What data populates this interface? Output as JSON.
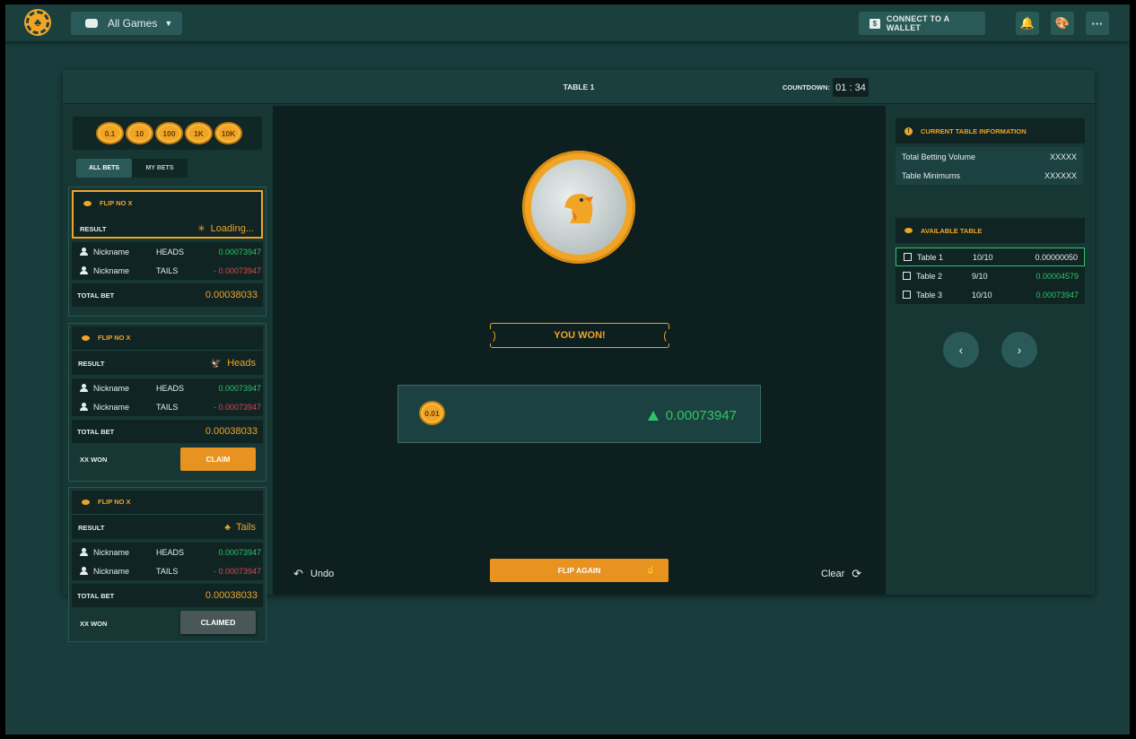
{
  "header": {
    "games_label": "All Games",
    "wallet_label": "CONNECT TO A WALLET"
  },
  "table": {
    "title": "TABLE 1",
    "countdown_label": "COUNTDOWN:",
    "countdown_value": "01 : 34"
  },
  "chips": [
    "0.1",
    "10",
    "100",
    "1K",
    "10K"
  ],
  "bet_tabs": [
    "ALL BETS",
    "MY BETS"
  ],
  "cards": [
    {
      "flip_label": "FLIP NO X",
      "result_label": "RESULT",
      "result_value": "Loading...",
      "bets": [
        {
          "nick": "Nickname",
          "side": "HEADS",
          "amount": "0.00073947"
        },
        {
          "nick": "Nickname",
          "side": "TAILS",
          "amount": "- 0.00073947"
        }
      ],
      "total_label": "TOTAL BET",
      "total_value": "0.00038033"
    },
    {
      "flip_label": "FLIP NO X",
      "result_label": "RESULT",
      "result_value": "Heads",
      "bets": [
        {
          "nick": "Nickname",
          "side": "HEADS",
          "amount": "0.00073947"
        },
        {
          "nick": "Nickname",
          "side": "TAILS",
          "amount": "- 0.00073947"
        }
      ],
      "total_label": "TOTAL BET",
      "total_value": "0.00038033",
      "won_label": "XX WON",
      "action_label": "CLAIM"
    },
    {
      "flip_label": "FLIP NO X",
      "result_label": "RESULT",
      "result_value": "Tails",
      "bets": [
        {
          "nick": "Nickname",
          "side": "HEADS",
          "amount": "0.00073947"
        },
        {
          "nick": "Nickname",
          "side": "TAILS",
          "amount": "- 0.00073947"
        }
      ],
      "total_label": "TOTAL BET",
      "total_value": "0.00038033",
      "won_label": "XX WON",
      "action_label": "CLAIMED"
    }
  ],
  "center": {
    "result_banner": "YOU WON!",
    "chip_value": "0.01",
    "win_amount": "0.00073947",
    "undo_label": "Undo",
    "flip_again_label": "FLIP AGAIN",
    "clear_label": "Clear"
  },
  "info": {
    "title": "CURRENT TABLE INFORMATION",
    "rows": [
      {
        "label": "Total Betting Volume",
        "value": "XXXXX"
      },
      {
        "label": "Table Minimums",
        "value": "XXXXXX"
      }
    ]
  },
  "available": {
    "title": "AVAILABLE TABLE",
    "tables": [
      {
        "name": "Table 1",
        "count": "10/10",
        "value": "0.00000050"
      },
      {
        "name": "Table 2",
        "count": "9/10",
        "value": "0.00004579"
      },
      {
        "name": "Table 3",
        "count": "10/10",
        "value": "0.00073947"
      }
    ]
  },
  "colors": {
    "accent": "#f0a526",
    "positive": "#2fc46a",
    "negative": "#e0474c",
    "background": "#193d3c"
  }
}
